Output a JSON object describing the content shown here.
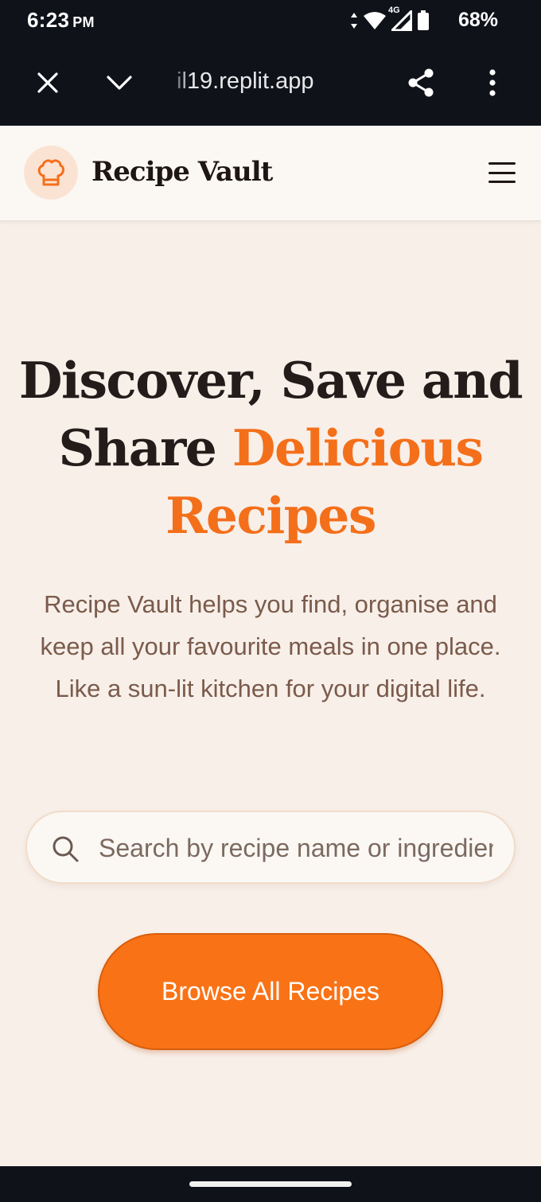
{
  "status_bar": {
    "time": "6:23",
    "ampm": "PM",
    "network": "4G",
    "battery": "68%",
    "icons": [
      "data-arrows-icon",
      "wifi-icon",
      "signal-icon",
      "battery-icon"
    ]
  },
  "browser": {
    "url": "il19.replit.app",
    "icons": [
      "close-icon",
      "chevron-down-icon",
      "share-icon",
      "more-vert-icon"
    ]
  },
  "header": {
    "brand": "Recipe Vault",
    "logo_icon": "chef-hat-icon",
    "menu_icon": "hamburger-menu-icon"
  },
  "hero": {
    "title_part1": "Discover, Save and",
    "title_part2": "Share ",
    "title_accent": "Delicious Recipes",
    "subtitle": "Recipe Vault helps you find, organise and keep all your favourite meals in one place. Like a sun-lit kitchen for your digital life."
  },
  "search": {
    "placeholder": "Search by recipe name or ingredient...",
    "value": "",
    "icon": "search-icon"
  },
  "cta": {
    "label": "Browse All Recipes"
  },
  "colors": {
    "accent": "#f97316",
    "background": "#f8efe9",
    "header_bg": "#fbf8f4",
    "system_bar": "#0f1219",
    "title_text": "#241c1a",
    "body_text": "#7a5b4b"
  }
}
